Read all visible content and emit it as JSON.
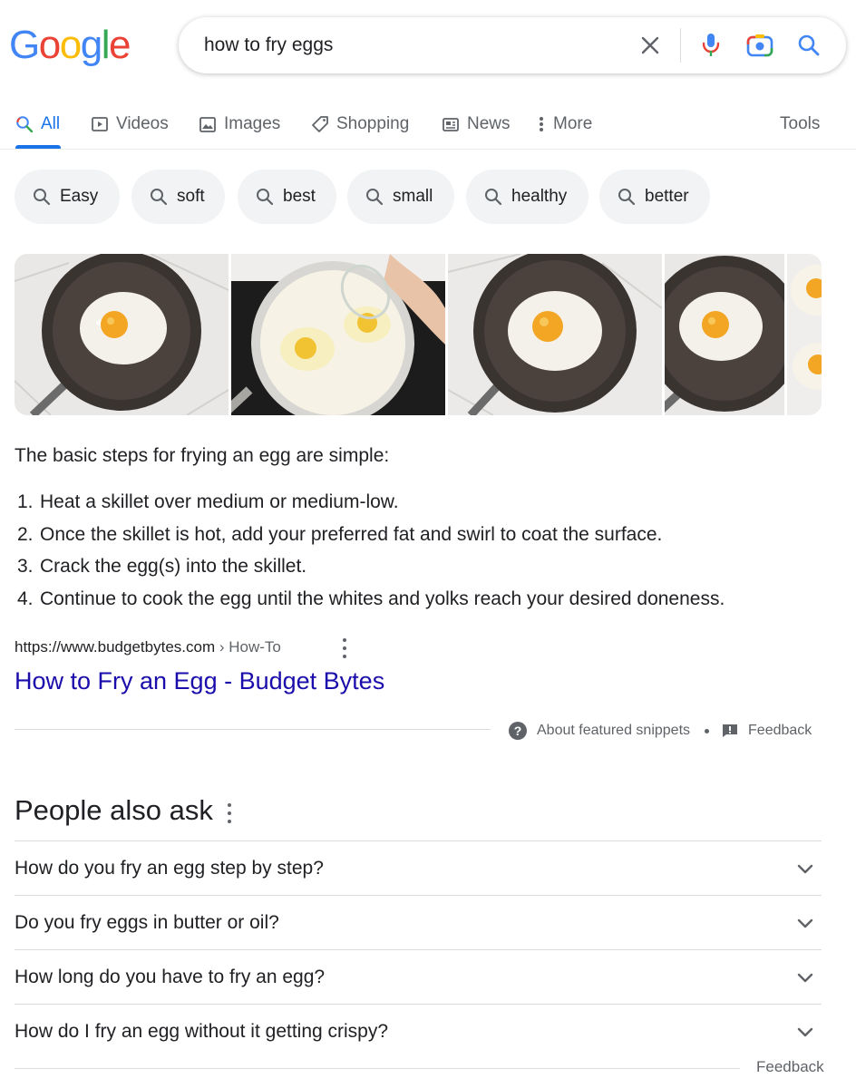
{
  "logo": {
    "letters": [
      "G",
      "o",
      "o",
      "g",
      "l",
      "e"
    ],
    "colors": [
      "#4285f4",
      "#ea4335",
      "#fbbc05",
      "#4285f4",
      "#34a853",
      "#ea4335"
    ]
  },
  "search": {
    "query": "how to fry eggs"
  },
  "tabs": [
    {
      "label": "All",
      "icon": "search-icon",
      "active": true
    },
    {
      "label": "Videos",
      "icon": "play-icon"
    },
    {
      "label": "Images",
      "icon": "image-icon"
    },
    {
      "label": "Shopping",
      "icon": "tag-icon"
    },
    {
      "label": "News",
      "icon": "newspaper-icon"
    },
    {
      "label": "More",
      "icon": "more-vert-icon"
    }
  ],
  "tools_label": "Tools",
  "chips": [
    "Easy",
    "soft",
    "best",
    "small",
    "healthy",
    "better"
  ],
  "featured_snippet": {
    "intro": "The basic steps for frying an egg are simple:",
    "steps": [
      {
        "num": "1.",
        "text": "Heat a skillet over medium or medium-low."
      },
      {
        "num": "2.",
        "text": "Once the skillet is hot, add your preferred fat and swirl to coat the surface."
      },
      {
        "num": "3.",
        "text": "Crack the egg(s) into the skillet."
      },
      {
        "num": "4.",
        "text": "Continue to cook the egg until the whites and yolks reach your desired doneness."
      }
    ],
    "source_url": "https://www.budgetbytes.com",
    "breadcrumb": " › How-To",
    "title": "How to Fry an Egg - Budget Bytes",
    "about_label": "About featured snippets",
    "feedback_label": "Feedback"
  },
  "people_also_ask": {
    "title": "People also ask",
    "questions": [
      "How do you fry an egg step by step?",
      "Do you fry eggs in butter or oil?",
      "How long do you have to fry an egg?",
      "How do I fry an egg without it getting crispy?"
    ],
    "feedback_label": "Feedback"
  },
  "colors": {
    "accent": "#1a73e8",
    "link": "#1a0dab",
    "muted": "#5f6368",
    "chip_bg": "#f1f3f4"
  }
}
